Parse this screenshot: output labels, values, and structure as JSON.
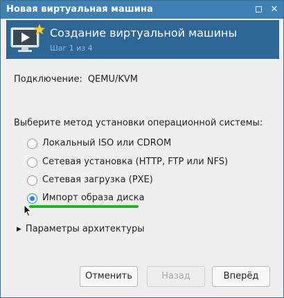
{
  "window": {
    "title": "Новая виртуальная машина"
  },
  "header": {
    "title": "Создание виртуальной машины",
    "step": "Шаг 1 из 4"
  },
  "connection": {
    "label": "Подключение:",
    "value": "QEMU/KVM"
  },
  "install": {
    "prompt": "Выберите метод установки операционной системы:",
    "options": [
      {
        "label": "Локальный ISO или CDROM",
        "selected": false
      },
      {
        "label": "Сетевая установка (HTTP, FTP или NFS)",
        "selected": false
      },
      {
        "label": "Сетевая загрузка (PXE)",
        "selected": false
      },
      {
        "label": "Импорт образа диска",
        "selected": true
      }
    ]
  },
  "arch": {
    "label": "Параметры архитектуры",
    "expanded": false
  },
  "buttons": {
    "cancel": "Отменить",
    "back": "Назад",
    "forward": "Вперёд"
  },
  "colors": {
    "titlebar": "#3f7fb2",
    "header": "#2e6796",
    "accent": "#2f7ed8",
    "highlight": "#21b51f"
  }
}
